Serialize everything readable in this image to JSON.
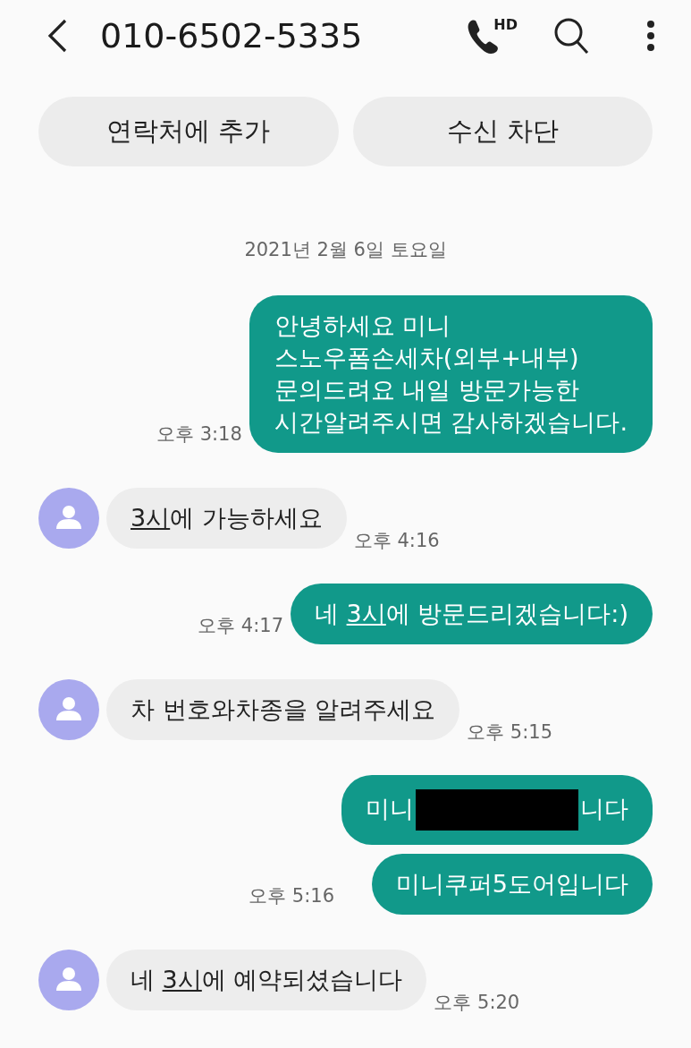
{
  "header": {
    "title": "010-6502-5335",
    "call_badge": "HD"
  },
  "actions": [
    "연락처에 추가",
    "수신 차단"
  ],
  "date": "2021년 2월 6일 토요일",
  "messages": [
    {
      "kind": "outgoing",
      "time": "오후 3:18",
      "bubbles": [
        {
          "parts": [
            {
              "kind": "text",
              "text": "안녕하세요 미니\n스노우폼손세차(외부+내부)\n문의드려요 내일 방문가능한\n시간알려주시면 감사하겠습니다."
            }
          ]
        }
      ]
    },
    {
      "kind": "incoming",
      "time": "오후 4:16",
      "bubbles": [
        {
          "parts": [
            {
              "kind": "link",
              "text": "3시"
            },
            {
              "kind": "text",
              "text": "에 가능하세요"
            }
          ]
        }
      ]
    },
    {
      "kind": "outgoing",
      "time": "오후 4:17",
      "bubbles": [
        {
          "parts": [
            {
              "kind": "text",
              "text": "네 "
            },
            {
              "kind": "link",
              "text": "3시"
            },
            {
              "kind": "text",
              "text": "에 방문드리겠습니다:)"
            }
          ]
        }
      ]
    },
    {
      "kind": "incoming",
      "time": "오후 5:15",
      "bubbles": [
        {
          "parts": [
            {
              "kind": "text",
              "text": "차 번호와차종을 알려주세요"
            }
          ]
        }
      ]
    },
    {
      "kind": "outgoing",
      "time": "오후 5:16",
      "bubbles": [
        {
          "parts": [
            {
              "kind": "text",
              "text": "미니"
            },
            {
              "kind": "redaction"
            },
            {
              "kind": "text",
              "text": "니다"
            }
          ]
        },
        {
          "parts": [
            {
              "kind": "text",
              "text": "미니쿠퍼5도어입니다"
            }
          ]
        }
      ]
    },
    {
      "kind": "incoming",
      "time": "오후 5:20",
      "bubbles": [
        {
          "parts": [
            {
              "kind": "text",
              "text": "네 "
            },
            {
              "kind": "link",
              "text": "3시"
            },
            {
              "kind": "text",
              "text": "에 예약되셨습니다"
            }
          ]
        }
      ]
    }
  ]
}
